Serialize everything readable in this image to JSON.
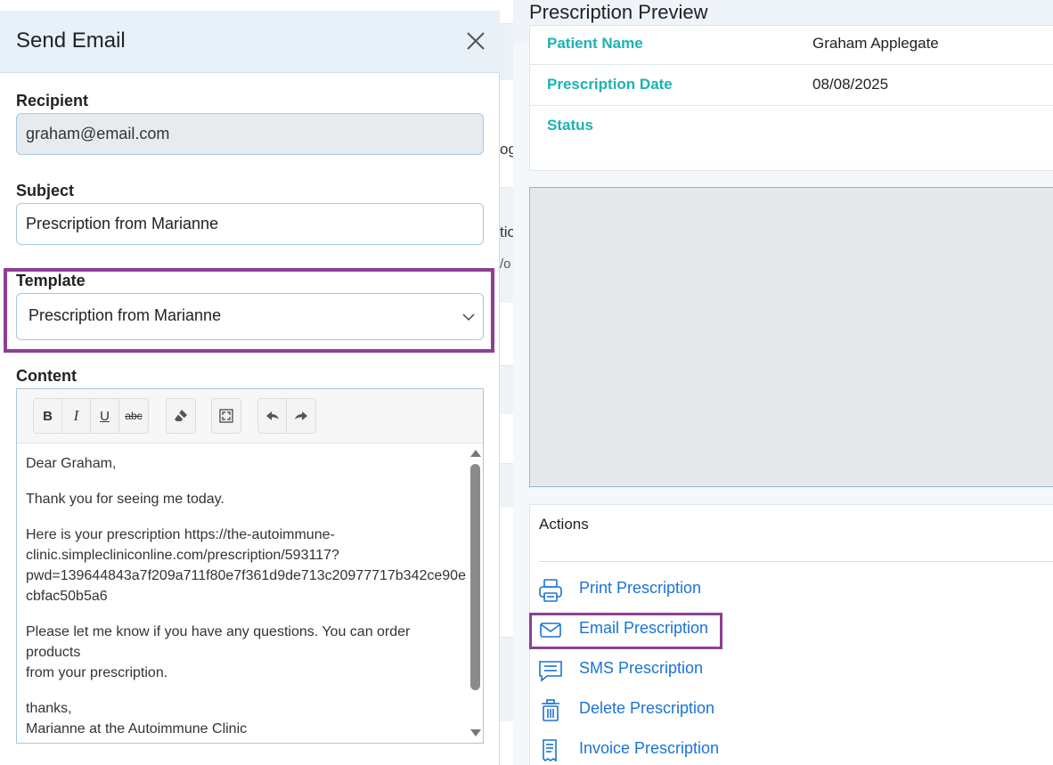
{
  "modal": {
    "title": "Send Email",
    "recipient": {
      "label": "Recipient",
      "value": "graham@email.com"
    },
    "subject": {
      "label": "Subject",
      "value": "Prescription from Marianne"
    },
    "template": {
      "label": "Template",
      "selected": "Prescription from Marianne"
    },
    "content": {
      "label": "Content",
      "toolbar": {
        "bold": "B",
        "italic": "I",
        "underline": "U",
        "strike": "abc"
      },
      "greeting": "Dear Graham,",
      "line1": "Thank you for seeing me today.",
      "link_intro": "Here is your prescription https://the-autoimmune-",
      "link_2": "clinic.simplecliniconline.com/prescription/593117?",
      "link_3": "pwd=139644843a7f209a711f80e7f361d9de713c20977717b342ce90e",
      "link_4": "cbfac50b5a6",
      "line3a": "Please let me know if you have any questions. You can order products",
      "line3b": "from your prescription.",
      "signoff": "thanks,",
      "signature": "Marianne at the Autoimmune Clinic"
    }
  },
  "background": {
    "frag1": "og",
    "frag2": "tio",
    "frag3": "/o"
  },
  "preview": {
    "title": "Prescription Preview",
    "rows": [
      {
        "label": "Patient Name",
        "value": "Graham Applegate"
      },
      {
        "label": "Prescription Date",
        "value": "08/08/2025"
      },
      {
        "label": "Status",
        "value": ""
      }
    ],
    "actions": {
      "title": "Actions",
      "items": [
        {
          "label": "Print Prescription",
          "icon": "printer-icon"
        },
        {
          "label": "Email Prescription",
          "icon": "envelope-icon"
        },
        {
          "label": "SMS Prescription",
          "icon": "chat-icon"
        },
        {
          "label": "Delete Prescription",
          "icon": "trash-icon"
        },
        {
          "label": "Invoice Prescription",
          "icon": "invoice-icon"
        }
      ]
    }
  },
  "colors": {
    "accent_teal": "#1bb3b3",
    "link_blue": "#1a73d4",
    "highlight_purple": "#8e3f96"
  }
}
